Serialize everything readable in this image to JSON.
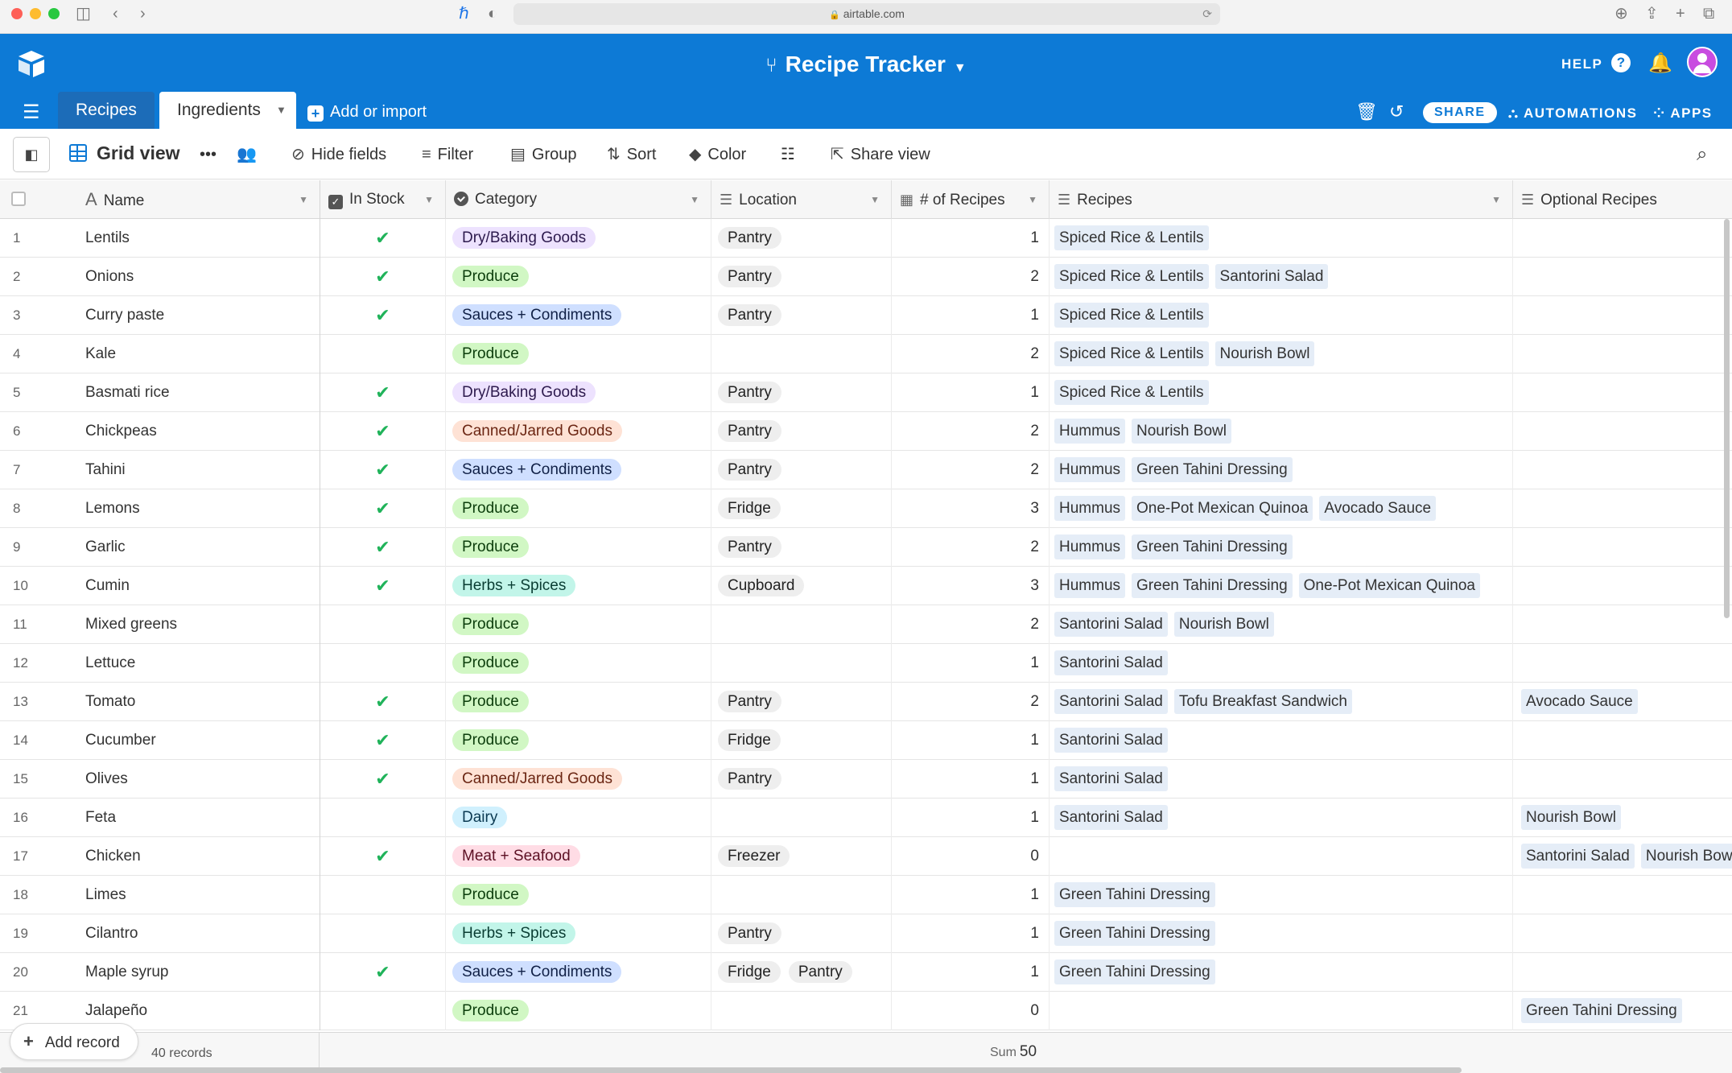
{
  "browser": {
    "url": "airtable.com"
  },
  "header": {
    "base_title": "Recipe Tracker",
    "help_label": "HELP",
    "tabs": [
      {
        "label": "Recipes"
      },
      {
        "label": "Ingredients"
      }
    ],
    "add_import_label": "Add or import",
    "share_label": "SHARE",
    "automations_label": "AUTOMATIONS",
    "apps_label": "APPS",
    "colors": {
      "header_bg": "#0d7ad6",
      "recipes_tab_bg": "#1c6cb8"
    }
  },
  "toolbar": {
    "view_name": "Grid view",
    "hide_fields": "Hide fields",
    "filter": "Filter",
    "group": "Group",
    "sort": "Sort",
    "color": "Color",
    "share_view": "Share view"
  },
  "columns": {
    "name": "Name",
    "in_stock": "In Stock",
    "category": "Category",
    "location": "Location",
    "count": "# of Recipes",
    "recipes": "Recipes",
    "optional": "Optional Recipes"
  },
  "category_colors": {
    "Dry/Baking Goods": {
      "bg": "#ede2fe",
      "fg": "#2d1a4d"
    },
    "Produce": {
      "bg": "#d1f7c4",
      "fg": "#0b3d0b"
    },
    "Sauces + Condiments": {
      "bg": "#cfdfff",
      "fg": "#102046"
    },
    "Canned/Jarred Goods": {
      "bg": "#fee2d5",
      "fg": "#6b2613"
    },
    "Herbs + Spices": {
      "bg": "#c2f5e9",
      "fg": "#0a3d33"
    },
    "Dairy": {
      "bg": "#d0f0fd",
      "fg": "#0b3a52"
    },
    "Meat + Seafood": {
      "bg": "#ffdce5",
      "fg": "#5c1024"
    }
  },
  "rows": [
    {
      "num": "1",
      "name": "Lentils",
      "in_stock": true,
      "category": "Dry/Baking Goods",
      "location": [
        "Pantry"
      ],
      "count": "1",
      "recipes": [
        "Spiced Rice & Lentils"
      ],
      "optional": []
    },
    {
      "num": "2",
      "name": "Onions",
      "in_stock": true,
      "category": "Produce",
      "location": [
        "Pantry"
      ],
      "count": "2",
      "recipes": [
        "Spiced Rice & Lentils",
        "Santorini Salad"
      ],
      "optional": []
    },
    {
      "num": "3",
      "name": "Curry paste",
      "in_stock": true,
      "category": "Sauces + Condiments",
      "location": [
        "Pantry"
      ],
      "count": "1",
      "recipes": [
        "Spiced Rice & Lentils"
      ],
      "optional": []
    },
    {
      "num": "4",
      "name": "Kale",
      "in_stock": false,
      "category": "Produce",
      "location": [],
      "count": "2",
      "recipes": [
        "Spiced Rice & Lentils",
        "Nourish Bowl"
      ],
      "optional": []
    },
    {
      "num": "5",
      "name": "Basmati rice",
      "in_stock": true,
      "category": "Dry/Baking Goods",
      "location": [
        "Pantry"
      ],
      "count": "1",
      "recipes": [
        "Spiced Rice & Lentils"
      ],
      "optional": []
    },
    {
      "num": "6",
      "name": "Chickpeas",
      "in_stock": true,
      "category": "Canned/Jarred Goods",
      "location": [
        "Pantry"
      ],
      "count": "2",
      "recipes": [
        "Hummus",
        "Nourish Bowl"
      ],
      "optional": []
    },
    {
      "num": "7",
      "name": "Tahini",
      "in_stock": true,
      "category": "Sauces + Condiments",
      "location": [
        "Pantry"
      ],
      "count": "2",
      "recipes": [
        "Hummus",
        "Green Tahini Dressing"
      ],
      "optional": []
    },
    {
      "num": "8",
      "name": "Lemons",
      "in_stock": true,
      "category": "Produce",
      "location": [
        "Fridge"
      ],
      "count": "3",
      "recipes": [
        "Hummus",
        "One-Pot Mexican Quinoa",
        "Avocado Sauce"
      ],
      "optional": []
    },
    {
      "num": "9",
      "name": "Garlic",
      "in_stock": true,
      "category": "Produce",
      "location": [
        "Pantry"
      ],
      "count": "2",
      "recipes": [
        "Hummus",
        "Green Tahini Dressing"
      ],
      "optional": []
    },
    {
      "num": "10",
      "name": "Cumin",
      "in_stock": true,
      "category": "Herbs + Spices",
      "location": [
        "Cupboard"
      ],
      "count": "3",
      "recipes": [
        "Hummus",
        "Green Tahini Dressing",
        "One-Pot Mexican Quinoa"
      ],
      "optional": []
    },
    {
      "num": "11",
      "name": "Mixed greens",
      "in_stock": false,
      "category": "Produce",
      "location": [],
      "count": "2",
      "recipes": [
        "Santorini Salad",
        "Nourish Bowl"
      ],
      "optional": []
    },
    {
      "num": "12",
      "name": "Lettuce",
      "in_stock": false,
      "category": "Produce",
      "location": [],
      "count": "1",
      "recipes": [
        "Santorini Salad"
      ],
      "optional": []
    },
    {
      "num": "13",
      "name": "Tomato",
      "in_stock": true,
      "category": "Produce",
      "location": [
        "Pantry"
      ],
      "count": "2",
      "recipes": [
        "Santorini Salad",
        "Tofu Breakfast Sandwich"
      ],
      "optional": [
        "Avocado Sauce"
      ]
    },
    {
      "num": "14",
      "name": "Cucumber",
      "in_stock": true,
      "category": "Produce",
      "location": [
        "Fridge"
      ],
      "count": "1",
      "recipes": [
        "Santorini Salad"
      ],
      "optional": []
    },
    {
      "num": "15",
      "name": "Olives",
      "in_stock": true,
      "category": "Canned/Jarred Goods",
      "location": [
        "Pantry"
      ],
      "count": "1",
      "recipes": [
        "Santorini Salad"
      ],
      "optional": []
    },
    {
      "num": "16",
      "name": "Feta",
      "in_stock": false,
      "category": "Dairy",
      "location": [],
      "count": "1",
      "recipes": [
        "Santorini Salad"
      ],
      "optional": [
        "Nourish Bowl"
      ]
    },
    {
      "num": "17",
      "name": "Chicken",
      "in_stock": true,
      "category": "Meat + Seafood",
      "location": [
        "Freezer"
      ],
      "count": "0",
      "recipes": [],
      "optional": [
        "Santorini Salad",
        "Nourish Bowl"
      ]
    },
    {
      "num": "18",
      "name": "Limes",
      "in_stock": false,
      "category": "Produce",
      "location": [],
      "count": "1",
      "recipes": [
        "Green Tahini Dressing"
      ],
      "optional": []
    },
    {
      "num": "19",
      "name": "Cilantro",
      "in_stock": false,
      "category": "Herbs + Spices",
      "location": [
        "Pantry"
      ],
      "count": "1",
      "recipes": [
        "Green Tahini Dressing"
      ],
      "optional": []
    },
    {
      "num": "20",
      "name": "Maple syrup",
      "in_stock": true,
      "category": "Sauces + Condiments",
      "location": [
        "Fridge",
        "Pantry"
      ],
      "count": "1",
      "recipes": [
        "Green Tahini Dressing"
      ],
      "optional": []
    },
    {
      "num": "21",
      "name": "Jalapeño",
      "in_stock": false,
      "category": "Produce",
      "location": [],
      "count": "0",
      "recipes": [],
      "optional": [
        "Green Tahini Dressing"
      ]
    }
  ],
  "footer": {
    "add_record": "Add record",
    "records_count": "40 records",
    "sum_label": "Sum",
    "sum_value": "50"
  }
}
